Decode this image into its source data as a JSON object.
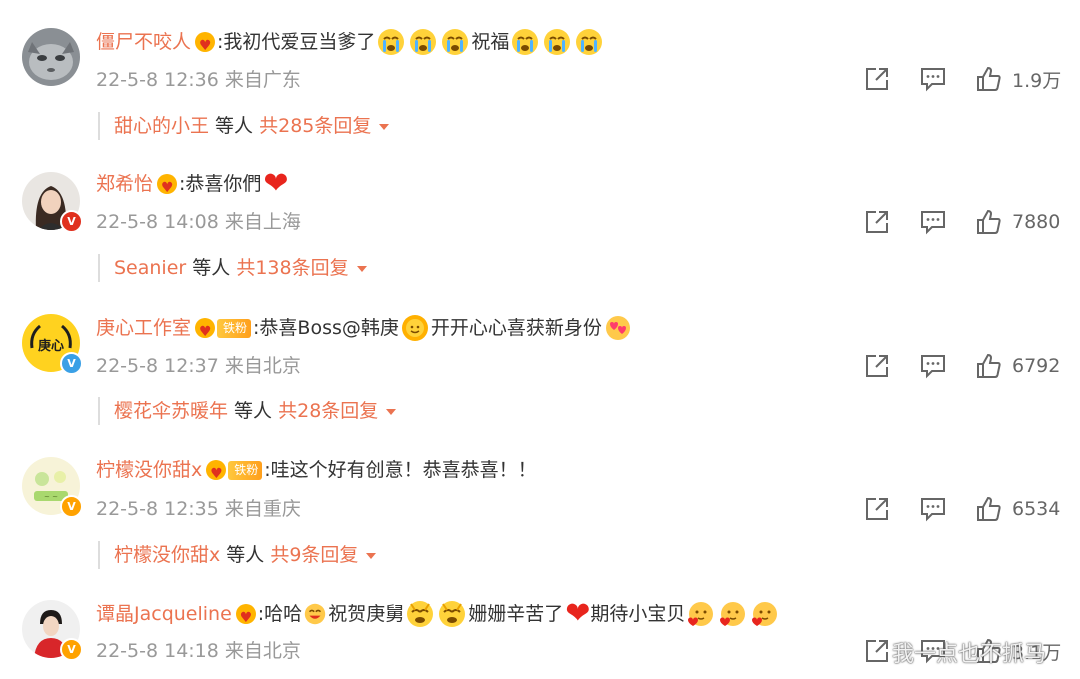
{
  "comments": [
    {
      "username": "僵尸不咬人",
      "text": ":我初代爱豆当爹了",
      "text_after": "祝福",
      "timestamp": "22-5-8 12:36 来自广东",
      "likes": "1.9万",
      "reply_user": "甜心的小王",
      "reply_mid": " 等人 ",
      "reply_count": "共285条回复",
      "avatar": "cat-avatar"
    },
    {
      "username": "郑希怡",
      "text": ":恭喜你們",
      "timestamp": "22-5-8 14:08 来自上海",
      "likes": "7880",
      "reply_user": "Seanier",
      "reply_mid": " 等人 ",
      "reply_count": "共138条回复",
      "avatar": "woman-avatar"
    },
    {
      "username": "庚心工作室",
      "fan_badge": "铁粉",
      "text": ":恭喜Boss@韩庚",
      "text_after": "开开心心喜获新身份",
      "timestamp": "22-5-8 12:37 来自北京",
      "likes": "6792",
      "reply_user": "樱花伞苏暖年",
      "reply_mid": " 等人 ",
      "reply_count": "共28条回复",
      "avatar": "studio-logo-avatar"
    },
    {
      "username": "柠檬没你甜x",
      "fan_badge": "铁粉",
      "text": ":哇这个好有创意！恭喜恭喜！！",
      "timestamp": "22-5-8 12:35 来自重庆",
      "likes": "6534",
      "reply_user": "柠檬没你甜x",
      "reply_mid": " 等人 ",
      "reply_count": "共9条回复",
      "avatar": "illustration-avatar"
    },
    {
      "username": "谭晶Jacqueline",
      "text": ":哈哈",
      "text_mid": "祝贺庚舅",
      "text_mid2": "姗姗辛苦了",
      "text_after": "期待小宝贝",
      "timestamp": "22-5-8 14:18 来自北京",
      "likes": "3.1万",
      "avatar": "singer-avatar"
    }
  ],
  "watermark": "我一点也不抓马",
  "colors": {
    "username": "#eb7350",
    "meta": "#999999",
    "text": "#333333",
    "verified": "#ffa200",
    "red_verified": "#e0301e"
  }
}
